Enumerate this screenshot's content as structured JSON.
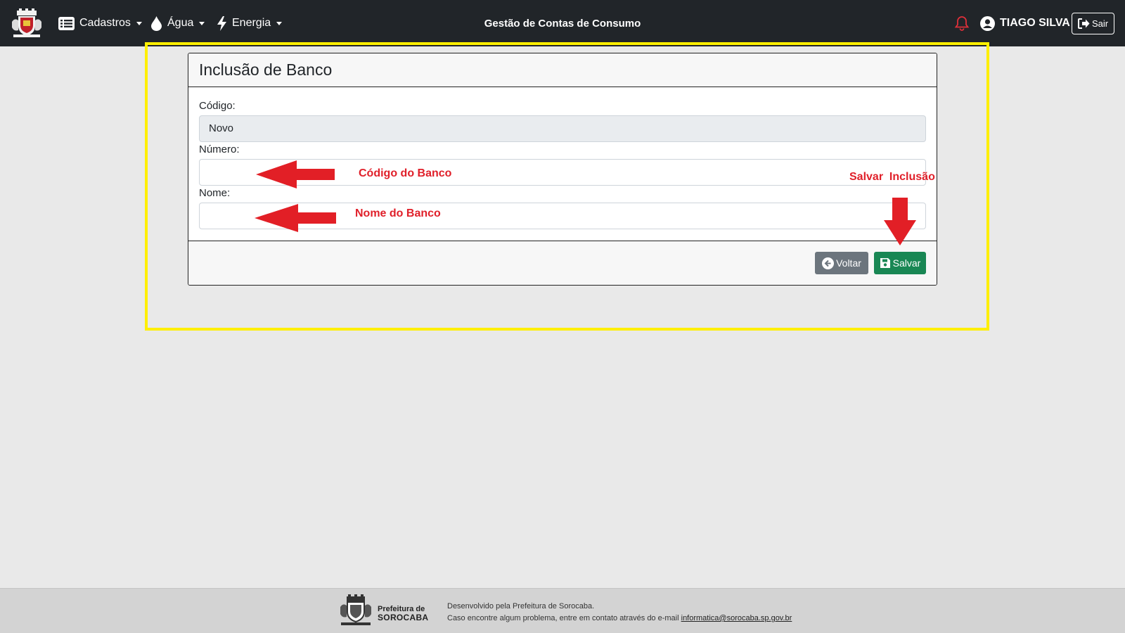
{
  "navbar": {
    "menu": [
      {
        "label": "Cadastros",
        "icon": "list-icon"
      },
      {
        "label": "Água",
        "icon": "water-drop-icon"
      },
      {
        "label": "Energia",
        "icon": "lightning-icon"
      }
    ],
    "title": "Gestão de Contas de Consumo",
    "user_name": "TIAGO SILVA",
    "logout_label": "Sair"
  },
  "form": {
    "title": "Inclusão de Banco",
    "fields": [
      {
        "label": "Código:",
        "value": "Novo",
        "readonly": true
      },
      {
        "label": "Número:",
        "value": ""
      },
      {
        "label": "Nome:",
        "value": ""
      }
    ],
    "back_label": "Voltar",
    "save_label": "Salvar"
  },
  "annotations": {
    "codigo": "Código do Banco",
    "nome": "Nome do Banco",
    "salvar": "Salvar  Inclusão"
  },
  "footer": {
    "brand_line1": "Prefeitura de",
    "brand_line2": "SOROCABA",
    "line1": "Desenvolvido pela Prefeitura de Sorocaba.",
    "line2": "Caso encontre algum problema, entre em contato através do e-mail",
    "email": "informatica@sorocaba.sp.gov.br"
  },
  "colors": {
    "navbar": "#212529",
    "highlight": "#ffef00",
    "annotation": "#e0202a",
    "save_button": "#198754",
    "back_button": "#6c757d"
  }
}
